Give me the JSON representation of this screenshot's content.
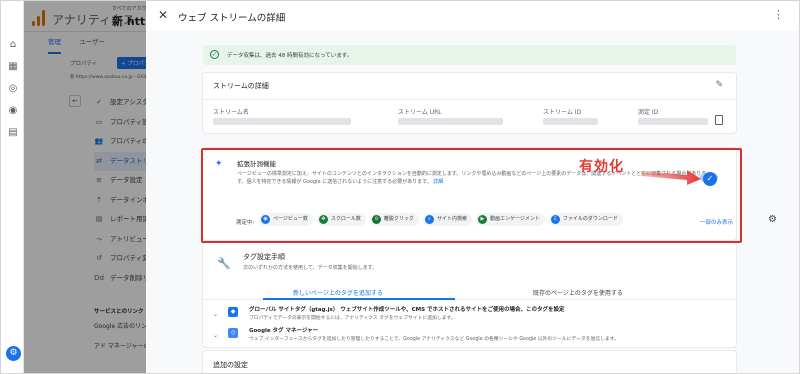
{
  "app": {
    "title": "アナリティクス",
    "account_small": "すべてのアカウント",
    "account_name": "新 https"
  },
  "tabs": [
    {
      "label": "管理"
    },
    {
      "label": "ユーザー"
    }
  ],
  "property": {
    "label": "プロパティ",
    "button": "+ プロパティを作成",
    "url": "新 https://www.asobou.co.jp - GA4"
  },
  "menu": [
    {
      "icon": "✓",
      "label": "設定アシスタント"
    },
    {
      "icon": "▭",
      "label": "プロパティ設定"
    },
    {
      "icon": "👥",
      "label": "プロパティのアクセス"
    },
    {
      "icon": "⇄",
      "label": "データストリーム"
    },
    {
      "icon": "≡",
      "label": "データ設定"
    },
    {
      "icon": "⇡",
      "label": "データインポート"
    },
    {
      "icon": "▤",
      "label": "レポート用識別子"
    },
    {
      "icon": "⤳",
      "label": "アトリビューション設"
    },
    {
      "icon": "↺",
      "label": "プロパティ変更履歴"
    },
    {
      "icon": "Dd",
      "label": "データ削除リクエスト"
    }
  ],
  "links_section": "サービスとのリンク",
  "links": [
    {
      "label": "Google 広告のリンク"
    },
    {
      "label": "アド マネージャーのリ"
    }
  ],
  "panel": {
    "title": "ウェブ ストリームの詳細",
    "banner": "データ収集は、過去 48 時間有効になっています。",
    "stream_card": {
      "title": "ストリームの詳細",
      "fields": [
        {
          "label": "ストリーム名"
        },
        {
          "label": "ストリーム URL"
        },
        {
          "label": "ストリーム ID"
        },
        {
          "label": "測定 ID"
        }
      ]
    },
    "enhanced": {
      "title": "拡張計測機能",
      "desc": "ページビューの標準測定に加え、サイトのコンテンツとのインタラクションを自動的に測定します。リンクや埋め込み動画などのページ上の要素のデータは、関連するイベントとともに収集される場合があります。個人を特定できる情報が Google に送信されないように注意する必要があります。",
      "link": "詳細",
      "measuring": "測定中:",
      "chips": [
        {
          "label": "ページビュー数",
          "icon": "◉",
          "color": "#1a73e8"
        },
        {
          "label": "スクロール数",
          "icon": "✥",
          "color": "#188038"
        },
        {
          "label": "離脱クリック",
          "icon": "⊙",
          "color": "#137333"
        },
        {
          "label": "サイト内検索",
          "icon": "⌕",
          "color": "#1a73e8"
        },
        {
          "label": "動画エンゲージメント",
          "icon": "▶",
          "color": "#188038"
        },
        {
          "label": "ファイルのダウンロード",
          "icon": "⇩",
          "color": "#1a73e8"
        }
      ],
      "only_one": "一部のみ表示"
    },
    "annotation": "有効化",
    "tag": {
      "title": "タグ設定手順",
      "subtitle": "次のいずれかの方法を使用して、データ収集を開始します。",
      "tab_new": "新しいページ上のタグを追加する",
      "tab_existing": "既存のページ上のタグを使用する",
      "rows": [
        {
          "title": "グローバル サイトタグ（gtag.js） ウェブサイト作成ツールや、CMS でホストされるサイトをご使用の場合、このタグを設定",
          "sub": "プロパティでデータの表示を開始するには、アナリティクス タグをウェブサイトに追加します。"
        },
        {
          "title": "Google タグ マネージャー",
          "sub": "ウェブ インターフェースからタグを追加したり管理したりすることで、Google アナリティクスなど Google の各種ツールや Google 以外のツールにデータを送信します。"
        }
      ]
    },
    "additional": "追加の設定"
  }
}
